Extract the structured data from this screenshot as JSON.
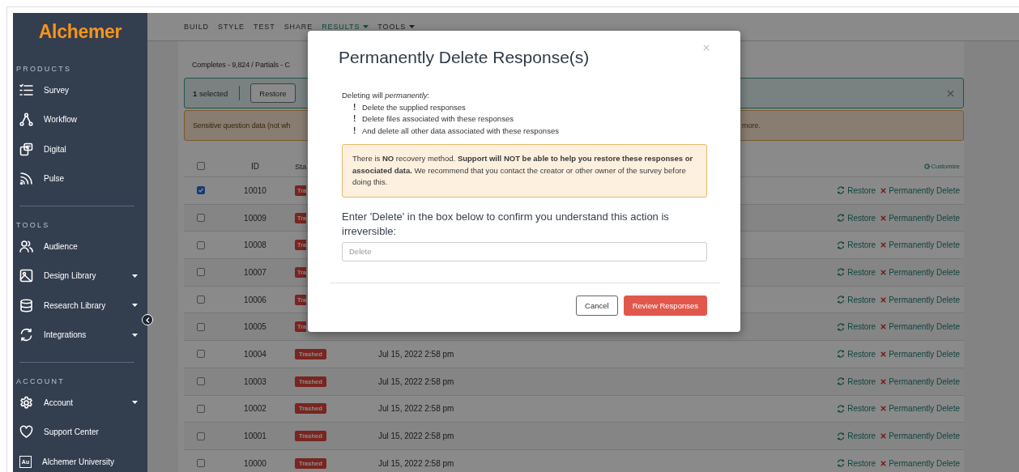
{
  "sidebar": {
    "logo": "Alchemer",
    "sections": [
      {
        "heading": "PRODUCTS",
        "items": [
          {
            "label": "Survey",
            "kind": "survey",
            "expandable": false
          },
          {
            "label": "Workflow",
            "kind": "workflow",
            "expandable": false
          },
          {
            "label": "Digital",
            "kind": "digital",
            "expandable": false
          },
          {
            "label": "Pulse",
            "kind": "pulse",
            "expandable": false
          }
        ]
      },
      {
        "heading": "TOOLS",
        "items": [
          {
            "label": "Audience",
            "kind": "audience",
            "expandable": false
          },
          {
            "label": "Design Library",
            "kind": "design",
            "expandable": true
          },
          {
            "label": "Research Library",
            "kind": "research",
            "expandable": true
          },
          {
            "label": "Integrations",
            "kind": "integrations",
            "expandable": true
          }
        ]
      },
      {
        "heading": "ACCOUNT",
        "items": [
          {
            "label": "Account",
            "kind": "account",
            "expandable": true
          },
          {
            "label": "Support Center",
            "kind": "support",
            "expandable": false
          },
          {
            "label": "Alchemer University",
            "kind": "university",
            "badge": "Au",
            "expandable": false
          }
        ]
      }
    ]
  },
  "nav": [
    {
      "label": "BUILD",
      "selected": false,
      "dropdown": false
    },
    {
      "label": "STYLE",
      "selected": false,
      "dropdown": false
    },
    {
      "label": "TEST",
      "selected": false,
      "dropdown": false
    },
    {
      "label": "SHARE",
      "selected": false,
      "dropdown": false
    },
    {
      "label": "RESULTS",
      "selected": true,
      "dropdown": true
    },
    {
      "label": "TOOLS",
      "selected": false,
      "dropdown": true
    }
  ],
  "page": {
    "summary": "Completes - 9,824 / Partials - C",
    "selection_bar": {
      "text": "**1** selected",
      "button": "Restore"
    },
    "notice": {
      "text": "Sensitive question data (not wh",
      "tail": "more."
    },
    "table": {
      "select_all": {
        "checked": false
      },
      "columns": [
        "ID",
        "Sta"
      ],
      "customize": "Customize",
      "rows": [
        {
          "checked": true,
          "id": "10010",
          "status": "Tra",
          "restore": "Restore",
          "delete": "Permanently Delete"
        },
        {
          "checked": false,
          "id": "10009",
          "status": "Tra",
          "restore": "Restore",
          "delete": "Permanently Delete"
        },
        {
          "checked": false,
          "id": "10008",
          "status": "Tra",
          "restore": "Restore",
          "delete": "Permanently Delete"
        },
        {
          "checked": false,
          "id": "10007",
          "status": "Tra",
          "restore": "Restore",
          "delete": "Permanently Delete"
        },
        {
          "checked": false,
          "id": "10006",
          "status": "Tra",
          "restore": "Restore",
          "delete": "Permanently Delete"
        },
        {
          "checked": false,
          "id": "10005",
          "status": "Tra",
          "restore": "Restore",
          "delete": "Permanently Delete"
        },
        {
          "checked": false,
          "id": "10004",
          "status": "Trashed",
          "date": "Jul 15, 2022 2:58 pm",
          "restore": "Restore",
          "delete": "Permanently Delete"
        },
        {
          "checked": false,
          "id": "10003",
          "status": "Trashed",
          "date": "Jul 15, 2022 2:58 pm",
          "restore": "Restore",
          "delete": "Permanently Delete"
        },
        {
          "checked": false,
          "id": "10002",
          "status": "Trashed",
          "date": "Jul 15, 2022 2:58 pm",
          "restore": "Restore",
          "delete": "Permanently Delete"
        },
        {
          "checked": false,
          "id": "10001",
          "status": "Trashed",
          "date": "Jul 15, 2022 2:58 pm",
          "restore": "Restore",
          "delete": "Permanently Delete"
        },
        {
          "checked": false,
          "id": "10000",
          "status": "Trashed",
          "date": "Jul 15, 2022 2:58 pm",
          "restore": "Restore",
          "delete": "Permanently Delete"
        }
      ]
    }
  },
  "modal": {
    "title": "Permanently Delete Response(s)",
    "intro": "Deleting will *permanently*:",
    "bullets": [
      {
        "mark": "!",
        "text": "Delete the supplied responses"
      },
      {
        "mark": "!",
        "text": "Delete files associated with these responses"
      },
      {
        "mark": "!",
        "text": "And delete all other data associated with these responses"
      }
    ],
    "alert": "There is **NO** recovery method. **Support will NOT be able to help you restore these responses or associated data.** We recommend that you contact the creator or other owner of the survey before doing this.",
    "prompt": "Enter 'Delete' in the box below to confirm you understand this action is irreversible:",
    "input": {
      "placeholder": "Delete"
    },
    "buttons": [
      {
        "label": "Cancel",
        "kind": "secondary"
      },
      {
        "label": "Review Responses",
        "kind": "primary"
      }
    ]
  }
}
